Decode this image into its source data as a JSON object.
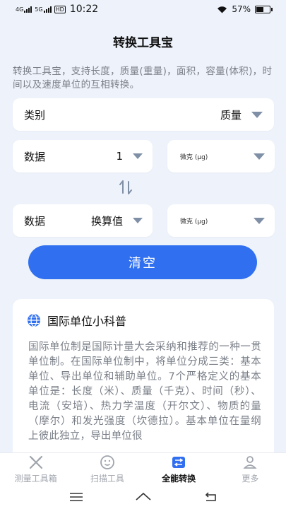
{
  "status": {
    "network1": "4G",
    "network2": "5G",
    "hd": "HD",
    "time": "10:22",
    "battery": "57%"
  },
  "page": {
    "title": "转换工具宝",
    "description": "转换工具宝，支持长度，质量(重量)，面积，容量(体积)，时间以及速度单位的互相转换。"
  },
  "category": {
    "label": "类别",
    "value": "质量"
  },
  "input1": {
    "label": "数据",
    "value": "1",
    "unit": "微克 (μg)"
  },
  "input2": {
    "label": "数据",
    "value": "换算值",
    "unit": "微克 (μg)"
  },
  "clear_button": "清空",
  "info": {
    "title": "国际单位小科普",
    "body": "国际单位制是国际计量大会采纳和推荐的一种一贯单位制。在国际单位制中，将单位分成三类：基本单位、导出单位和辅助单位。7个严格定义的基本单位是：长度（米）、质量（千克）、时间（秒）、电流（安培）、热力学温度（开尔文）、物质的量（摩尔）和发光强度（坎德拉）。基本单位在量纲上彼此独立，导出单位很"
  },
  "tabs": [
    {
      "label": "测量工具箱",
      "icon": "ruler-cross-icon",
      "active": false
    },
    {
      "label": "扫描工具",
      "icon": "scan-face-icon",
      "active": false
    },
    {
      "label": "全能转换",
      "icon": "convert-icon",
      "active": true
    },
    {
      "label": "更多",
      "icon": "user-icon",
      "active": false
    }
  ],
  "colors": {
    "accent": "#2f6ff0",
    "background": "#eef3fb",
    "triangle": "#7f8fa6"
  }
}
